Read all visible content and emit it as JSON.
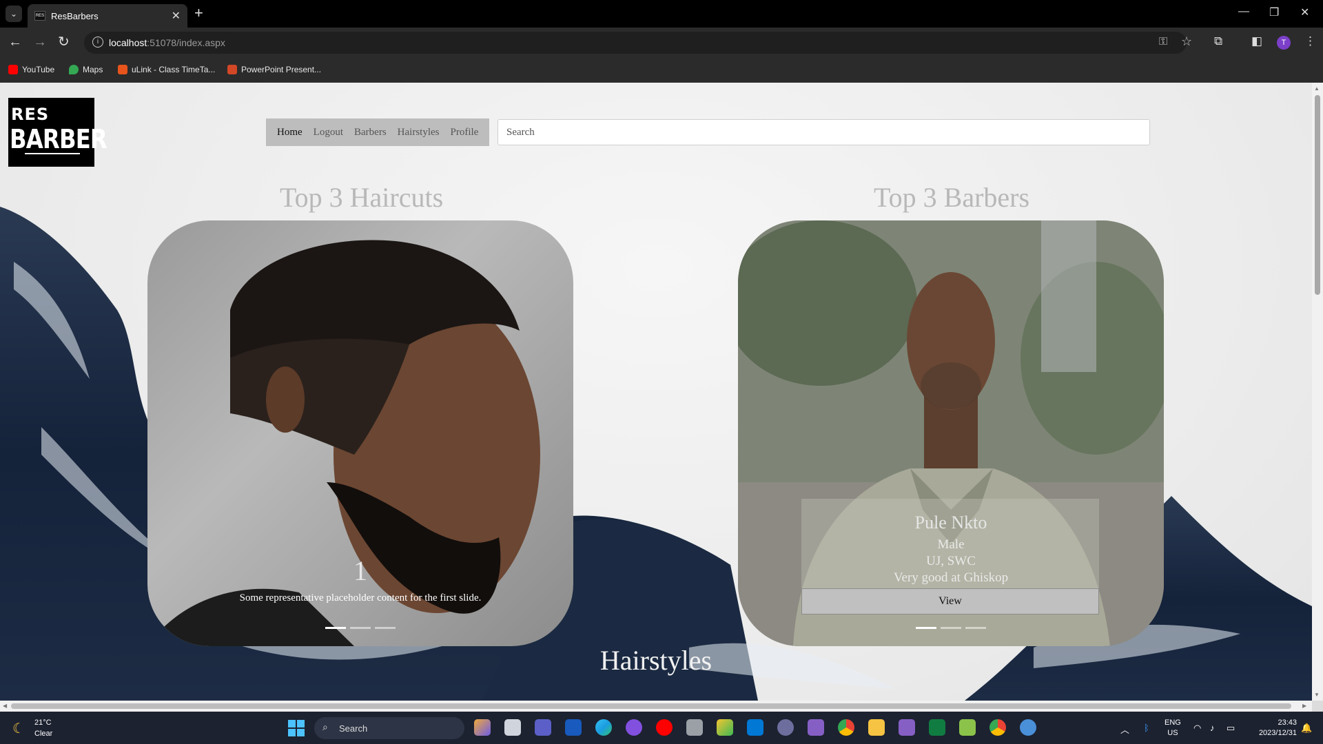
{
  "browser": {
    "tab_title": "ResBarbers",
    "tab_favicon_text": "RES",
    "url_host": "localhost",
    "url_rest": ":51078/index.aspx",
    "bookmarks": [
      {
        "label": "YouTube",
        "color": "#ff0000"
      },
      {
        "label": "Maps",
        "color": "#34a853"
      },
      {
        "label": "uLink - Class TimeTa...",
        "color": "#e8541c"
      },
      {
        "label": "PowerPoint Present...",
        "color": "#d24726"
      }
    ],
    "profile_initial": "T"
  },
  "site": {
    "logo_line1": "RES",
    "logo_line2": "BARBER",
    "nav": [
      "Home",
      "Logout",
      "Barbers",
      "Hairstyles",
      "Profile"
    ],
    "active_nav": "Home",
    "search_placeholder": "Search"
  },
  "haircuts": {
    "title": "Top 3 Haircuts",
    "slide_number": "1",
    "caption": "Some representative placeholder content for the first slide.",
    "slides": 3,
    "active_slide": 1
  },
  "barbers": {
    "title": "Top 3 Barbers",
    "name": "Pule Nkto",
    "gender": "Male",
    "location": "UJ, SWC",
    "description": "Very good at Ghiskop",
    "button_label": "View",
    "slides": 3,
    "active_slide": 1
  },
  "hairstyles_title": "Hairstyles",
  "taskbar": {
    "temperature": "21°C",
    "condition": "Clear",
    "search_label": "Search",
    "lang_line1": "ENG",
    "lang_line2": "US",
    "time": "23:43",
    "date": "2023/12/31"
  }
}
